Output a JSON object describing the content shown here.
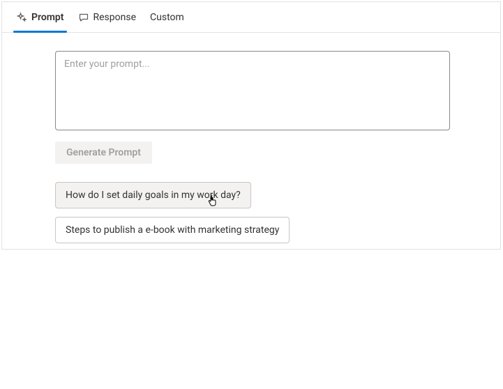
{
  "tabs": [
    {
      "label": "Prompt",
      "active": true
    },
    {
      "label": "Response",
      "active": false
    },
    {
      "label": "Custom",
      "active": false
    }
  ],
  "prompt": {
    "placeholder": "Enter your prompt..."
  },
  "generate_button": {
    "label": "Generate Prompt"
  },
  "suggestions": [
    {
      "label": "How do I set daily goals in my work day?",
      "hovered": true
    },
    {
      "label": "Steps to publish a e-book with marketing strategy",
      "hovered": false
    }
  ]
}
